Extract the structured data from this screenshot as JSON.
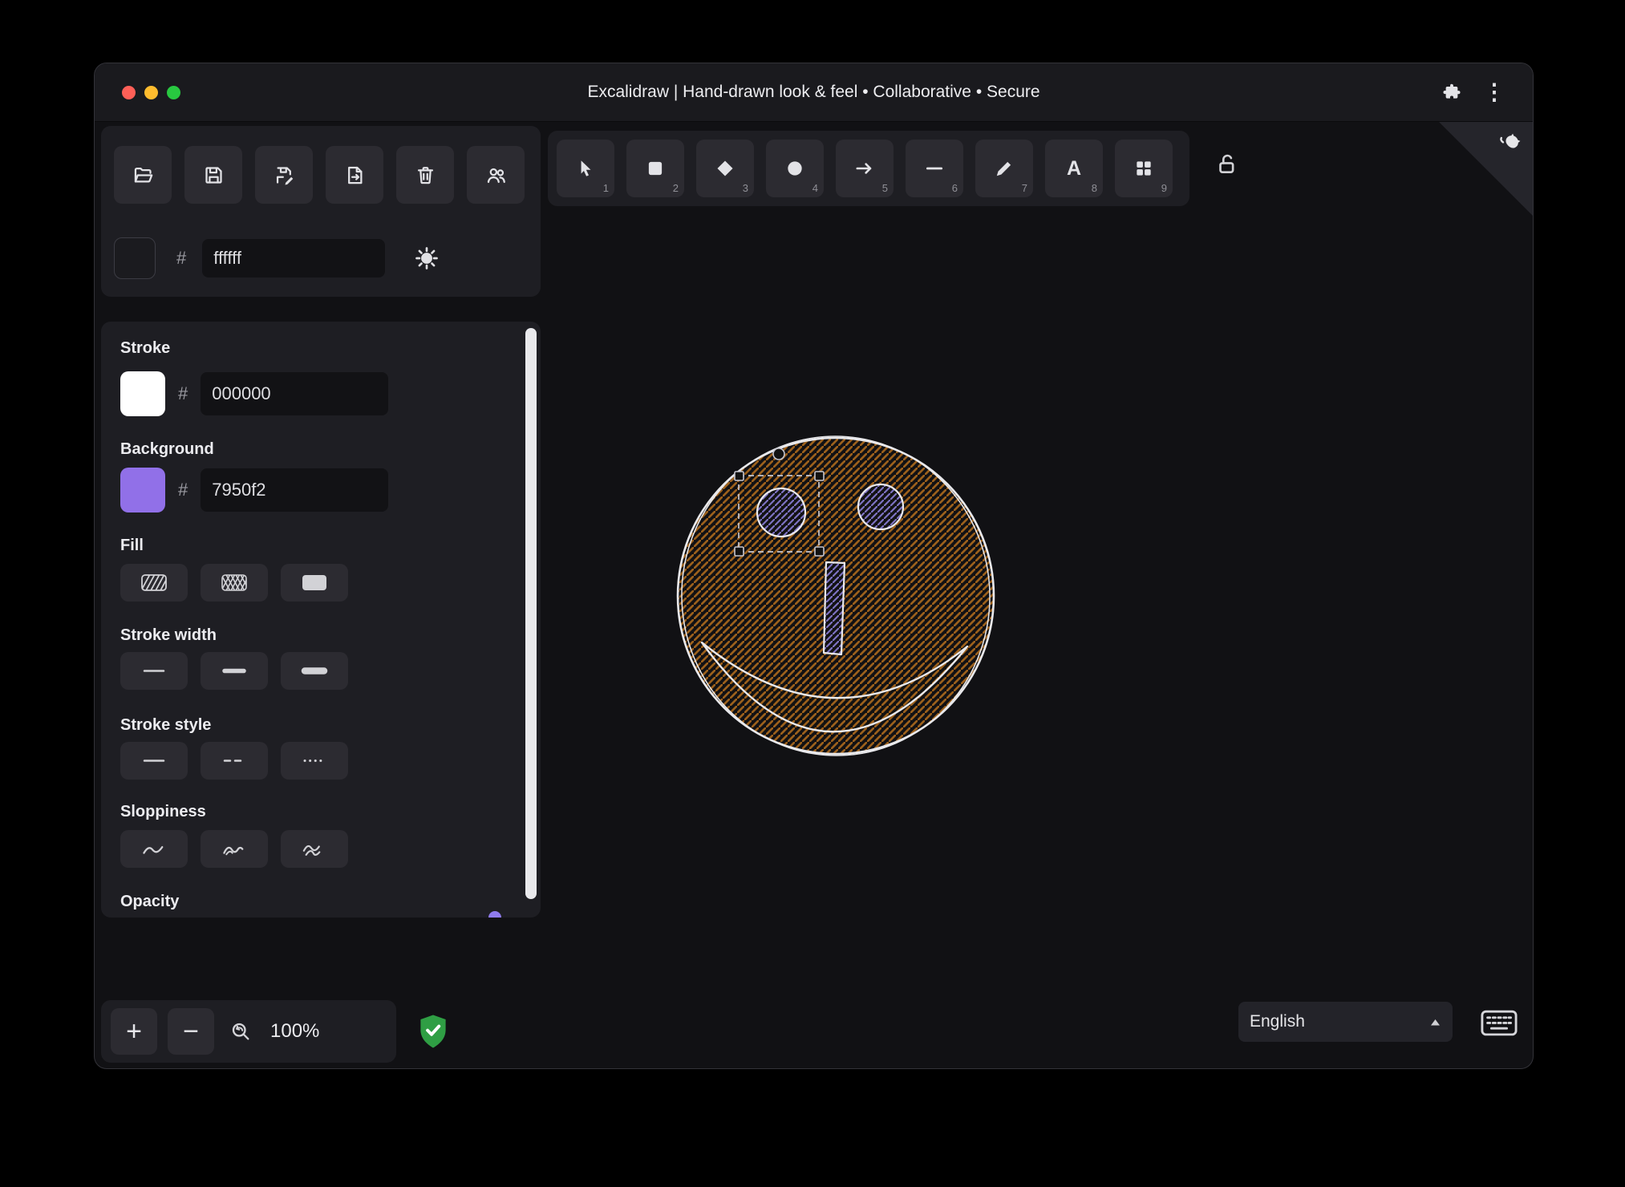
{
  "window": {
    "title": "Excalidraw | Hand-drawn look & feel • Collaborative • Secure"
  },
  "icons": {
    "hash": "#",
    "kebab": "⋮",
    "text_tool": "A",
    "plus": "+",
    "minus": "−"
  },
  "file_toolbar": {
    "buttons": [
      {
        "name": "open"
      },
      {
        "name": "save"
      },
      {
        "name": "save-as"
      },
      {
        "name": "export"
      },
      {
        "name": "clear-canvas"
      },
      {
        "name": "collaborators"
      }
    ]
  },
  "canvas_background": {
    "hex": "ffffff"
  },
  "tools": [
    {
      "name": "selection",
      "shortcut": "1"
    },
    {
      "name": "rectangle",
      "shortcut": "2"
    },
    {
      "name": "diamond",
      "shortcut": "3"
    },
    {
      "name": "ellipse",
      "shortcut": "4"
    },
    {
      "name": "arrow",
      "shortcut": "5"
    },
    {
      "name": "line",
      "shortcut": "6"
    },
    {
      "name": "draw",
      "shortcut": "7"
    },
    {
      "name": "text",
      "shortcut": "8"
    },
    {
      "name": "library",
      "shortcut": "9"
    }
  ],
  "panel": {
    "stroke": {
      "label": "Stroke",
      "hex": "000000"
    },
    "background": {
      "label": "Background",
      "hex": "7950f2"
    },
    "fill": {
      "label": "Fill",
      "options": [
        "hachure",
        "cross-hatch",
        "solid"
      ]
    },
    "stroke_width": {
      "label": "Stroke width",
      "options": [
        "thin",
        "bold",
        "extra bold"
      ]
    },
    "stroke_style": {
      "label": "Stroke style",
      "options": [
        "solid",
        "dashed",
        "dotted"
      ]
    },
    "sloppiness": {
      "label": "Sloppiness",
      "options": [
        "architect",
        "artist",
        "cartoonist"
      ]
    },
    "opacity": {
      "label": "Opacity"
    }
  },
  "zoom": {
    "value": "100%"
  },
  "language": {
    "value": "English"
  },
  "colors": {
    "traffic_red": "#ff5f57",
    "traffic_yellow": "#febc2e",
    "traffic_green": "#28c840",
    "canvas_swatch": "#1b1b1f",
    "stroke_swatch": "#ffffff",
    "background_swatch": "#9170e8",
    "accent": "#8f7bee",
    "shield_green": "#2f9e44",
    "face_hatch": "#9c601c",
    "eye_hatch": "#7d72c2",
    "outline": "#e9e9ec",
    "selection": "#c6c6cf"
  }
}
